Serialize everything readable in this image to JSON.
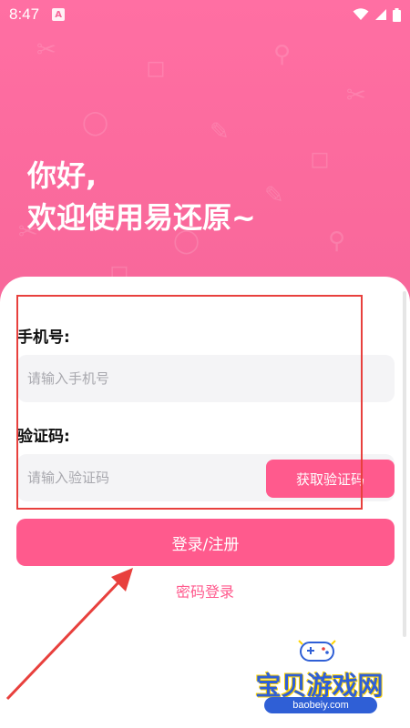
{
  "status_bar": {
    "time": "8:47",
    "notification_icon": "a-icon",
    "wifi_icon": "wifi-icon",
    "signal_icon": "signal-icon",
    "battery_icon": "battery-icon"
  },
  "hero": {
    "greeting_line1": "你好,",
    "greeting_line2": "欢迎使用易还原~",
    "background_color": "#fb6a9d"
  },
  "form": {
    "phone_label": "手机号:",
    "phone_placeholder": "请输入手机号",
    "code_label": "验证码:",
    "code_placeholder": "请输入验证码",
    "get_code_label": "获取验证码"
  },
  "actions": {
    "login_label": "登录/注册",
    "password_login_label": "密码登录",
    "accent_color": "#ff5a8d"
  },
  "annotation": {
    "highlight_color": "#e8403d"
  },
  "watermark": {
    "title": "宝贝游戏网",
    "url": "baobeiy.com"
  }
}
